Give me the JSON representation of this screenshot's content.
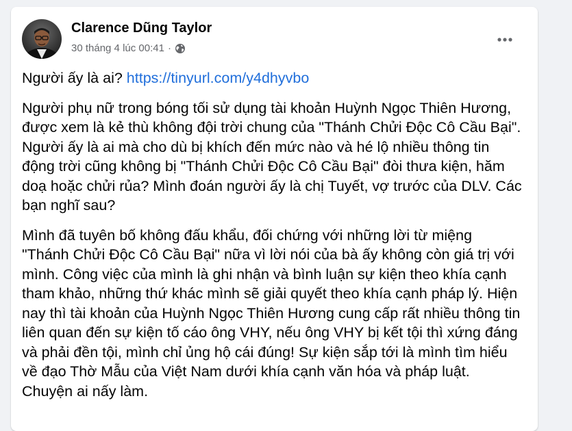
{
  "post": {
    "author_name": "Clarence Dũng Taylor",
    "timestamp": "30 tháng 4 lúc 00:41",
    "separator": "·",
    "privacy_icon": "globe-icon",
    "more_icon": "more-options-icon",
    "body": {
      "line1_text": "Người ấy là ai?",
      "line1_link": "https://tinyurl.com/y4dhyvbo",
      "paragraph2": "Người phụ nữ trong bóng tối sử dụng tài khoản Huỳnh Ngọc Thiên Hương, được xem là kẻ thù không đội trời chung của \"Thánh Chửi Độc Cô Cầu Bại\". Người ấy là ai mà cho dù bị khích đến mức nào và hé lộ nhiều thông tin động trời cũng không bị \"Thánh Chửi Độc Cô Cầu Bại\" đòi thưa kiện, hăm doạ hoặc chửi rủa? Mình đoán người ấy là chị Tuyết, vợ trước của DLV. Các bạn nghĩ sau?",
      "paragraph3": "Mình đã tuyên bố không đấu khẩu, đối chứng với những lời từ miệng \"Thánh Chửi Độc Cô Cầu Bại\" nữa vì lời nói của bà ấy không còn giá trị với mình. Công việc của mình là ghi nhận và bình luận sự kiện theo khía cạnh tham khảo, những thứ khác mình sẽ giải quyết theo khía cạnh pháp lý. Hiện nay thì tài khoản của Huỳnh Ngọc Thiên Hương cung cấp rất nhiều thông tin liên quan đến sự kiện tố cáo ông VHY, nếu ông VHY bị kết tội thì xứng đáng và phải đền tội, mình chỉ ủng hộ cái đúng! Sự kiện sắp tới là mình tìm hiểu về đạo Thờ Mẫu của Việt Nam dưới khía cạnh văn hóa và pháp luật. Chuyện ai nấy làm."
    }
  },
  "colors": {
    "link": "#216fdb",
    "text": "#050505",
    "meta": "#65676b",
    "background": "#f0f2f5"
  }
}
